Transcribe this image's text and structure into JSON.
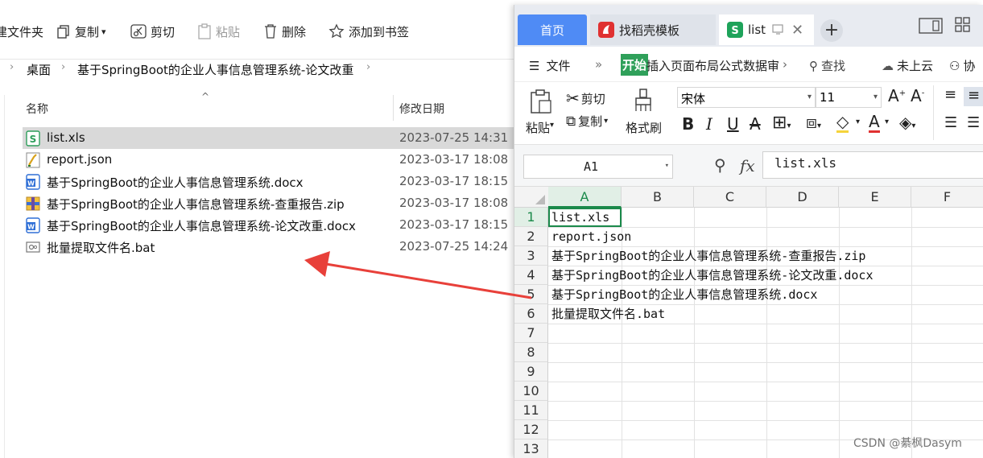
{
  "explorer": {
    "toolbar": {
      "new_folder": "建文件夹",
      "copy": "复制",
      "cut": "剪切",
      "paste": "粘贴",
      "delete": "删除",
      "bookmark": "添加到书签"
    },
    "breadcrumb": [
      "桌面",
      "基于SpringBoot的企业人事信息管理系统-论文改重"
    ],
    "columns": {
      "name": "名称",
      "date": "修改日期"
    },
    "files": [
      {
        "name": "list.xls",
        "date": "2023-07-25 14:31",
        "icon": "excel-icon",
        "selected": true
      },
      {
        "name": "report.json",
        "date": "2023-03-17 18:08",
        "icon": "json-icon",
        "selected": false
      },
      {
        "name": "基于SpringBoot的企业人事信息管理系统.docx",
        "date": "2023-03-17 18:15",
        "icon": "word-icon",
        "selected": false
      },
      {
        "name": "基于SpringBoot的企业人事信息管理系统-查重报告.zip",
        "date": "2023-03-17 18:08",
        "icon": "zip-icon",
        "selected": false
      },
      {
        "name": "基于SpringBoot的企业人事信息管理系统-论文改重.docx",
        "date": "2023-03-17 18:15",
        "icon": "word-icon",
        "selected": false
      },
      {
        "name": "批量提取文件名.bat",
        "date": "2023-07-25 14:24",
        "icon": "bat-icon",
        "selected": false
      }
    ]
  },
  "wps": {
    "tabs": {
      "home": "首页",
      "template": "找稻壳模板",
      "list": "list"
    },
    "menu": {
      "file": "文件",
      "start": "开始",
      "rest": "插入页面布局公式数据审",
      "search": "查找",
      "cloud": "未上云",
      "collab": "协"
    },
    "ribbon": {
      "paste": "粘贴",
      "cut": "剪切",
      "copy": "复制",
      "format_painter": "格式刷",
      "font_name": "宋体",
      "font_size": "11"
    },
    "formula_bar": {
      "name_box": "A1",
      "fx": "fx",
      "content": "list.xls"
    },
    "columns": [
      "A",
      "B",
      "C",
      "D",
      "E",
      "F"
    ],
    "rows": [
      "1",
      "2",
      "3",
      "4",
      "5",
      "6",
      "7",
      "8",
      "9",
      "10",
      "11",
      "12",
      "13"
    ],
    "cells": [
      "list.xls",
      "report.json",
      "基于SpringBoot的企业人事信息管理系统-查重报告.zip",
      "基于SpringBoot的企业人事信息管理系统-论文改重.docx",
      "基于SpringBoot的企业人事信息管理系统.docx",
      "批量提取文件名.bat"
    ]
  },
  "watermark": "CSDN @綦枫Dasym",
  "colors": {
    "accent_blue": "#4f8bf5",
    "excel_green": "#1b8a4b",
    "arrow_red": "#e8403a"
  }
}
